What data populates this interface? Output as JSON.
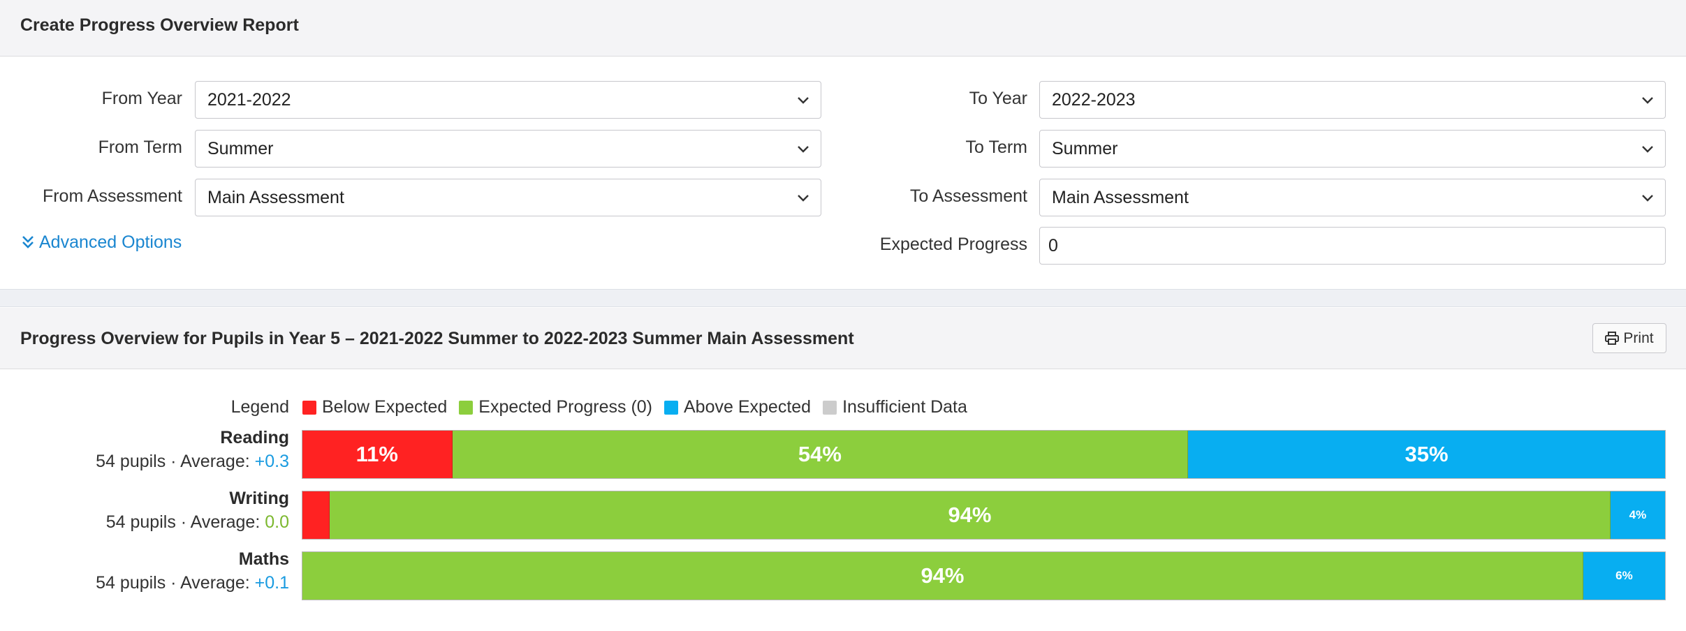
{
  "colors": {
    "below": "#ff2222",
    "expected": "#8cce3d",
    "above": "#08aef1",
    "insufficient": "#cccccc",
    "link": "#1a86d0"
  },
  "form_panel": {
    "title": "Create Progress Overview Report",
    "from_year": {
      "label": "From Year",
      "value": "2021-2022"
    },
    "from_term": {
      "label": "From Term",
      "value": "Summer"
    },
    "from_assessment": {
      "label": "From Assessment",
      "value": "Main Assessment"
    },
    "to_year": {
      "label": "To Year",
      "value": "2022-2023"
    },
    "to_term": {
      "label": "To Term",
      "value": "Summer"
    },
    "to_assessment": {
      "label": "To Assessment",
      "value": "Main Assessment"
    },
    "expected_progress": {
      "label": "Expected Progress",
      "value": "0"
    },
    "advanced_options_label": "Advanced Options",
    "advanced_options_icon": "double-chevron-down-icon"
  },
  "report_panel": {
    "title": "Progress Overview for Pupils in Year 5 – 2021-2022 Summer to 2022-2023 Summer Main Assessment",
    "print_label": "Print",
    "print_icon": "printer-icon",
    "legend": {
      "label": "Legend",
      "items": [
        {
          "key": "below",
          "label": "Below Expected"
        },
        {
          "key": "expected",
          "label": "Expected Progress (0)"
        },
        {
          "key": "above",
          "label": "Above Expected"
        },
        {
          "key": "insufficient",
          "label": "Insufficient Data"
        }
      ]
    },
    "rows": [
      {
        "subject": "Reading",
        "pupils": "54 pupils",
        "average_label": "Average:",
        "average_value": "+0.3",
        "average_color": "#1a9be0",
        "segments": [
          {
            "key": "below",
            "percent": 11,
            "label": "11%"
          },
          {
            "key": "expected",
            "percent": 54,
            "label": "54%"
          },
          {
            "key": "above",
            "percent": 35,
            "label": "35%"
          }
        ]
      },
      {
        "subject": "Writing",
        "pupils": "54 pupils",
        "average_label": "Average:",
        "average_value": "0.0",
        "average_color": "#7cb82f",
        "segments": [
          {
            "key": "below",
            "percent": 2,
            "label": ""
          },
          {
            "key": "expected",
            "percent": 94,
            "label": "94%"
          },
          {
            "key": "above",
            "percent": 4,
            "label": "4%"
          }
        ]
      },
      {
        "subject": "Maths",
        "pupils": "54 pupils",
        "average_label": "Average:",
        "average_value": "+0.1",
        "average_color": "#1a9be0",
        "segments": [
          {
            "key": "expected",
            "percent": 94,
            "label": "94%"
          },
          {
            "key": "above",
            "percent": 6,
            "label": "6%"
          }
        ]
      }
    ]
  }
}
